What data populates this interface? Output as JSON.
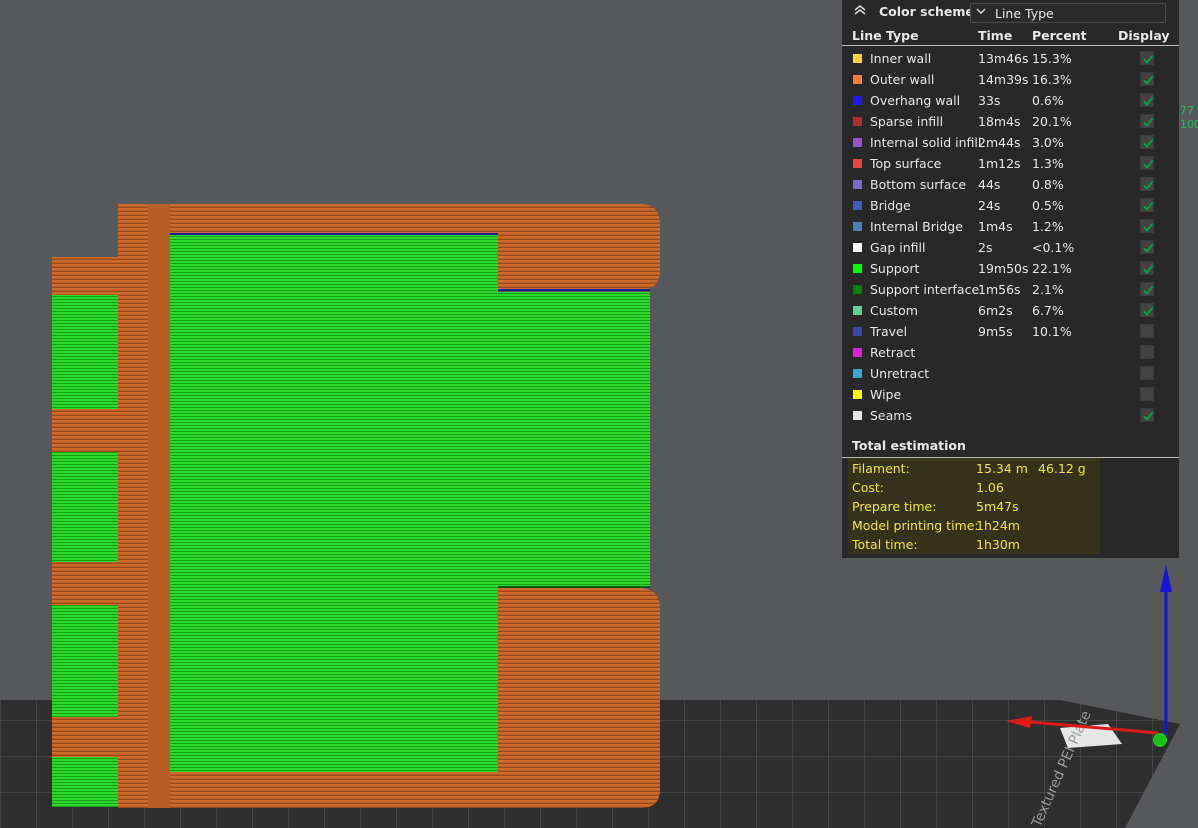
{
  "color_scheme": {
    "label": "Color scheme",
    "selected": "Line Type"
  },
  "legend": {
    "headers": {
      "line_type": "Line Type",
      "time": "Time",
      "percent": "Percent",
      "display": "Display"
    },
    "rows": [
      {
        "name": "Inner wall",
        "time": "13m46s",
        "percent": "15.3%",
        "color": "#ffd23f",
        "display": true
      },
      {
        "name": "Outer wall",
        "time": "14m39s",
        "percent": "16.3%",
        "color": "#ff7d38",
        "display": true
      },
      {
        "name": "Overhang wall",
        "time": "33s",
        "percent": "0.6%",
        "color": "#1a1aff",
        "display": true
      },
      {
        "name": "Sparse infill",
        "time": "18m4s",
        "percent": "20.1%",
        "color": "#b03029",
        "display": true
      },
      {
        "name": "Internal solid infill",
        "time": "2m44s",
        "percent": "3.0%",
        "color": "#9654cc",
        "display": true
      },
      {
        "name": "Top surface",
        "time": "1m12s",
        "percent": "1.3%",
        "color": "#f04040",
        "display": true
      },
      {
        "name": "Bottom surface",
        "time": "44s",
        "percent": "0.8%",
        "color": "#7a6cc4",
        "display": true
      },
      {
        "name": "Bridge",
        "time": "24s",
        "percent": "0.5%",
        "color": "#405cb8",
        "display": true
      },
      {
        "name": "Internal Bridge",
        "time": "1m4s",
        "percent": "1.2%",
        "color": "#4d80ba",
        "display": true
      },
      {
        "name": "Gap infill",
        "time": "2s",
        "percent": "<0.1%",
        "color": "#ffffff",
        "display": true
      },
      {
        "name": "Support",
        "time": "19m50s",
        "percent": "22.1%",
        "color": "#00ff00",
        "display": true
      },
      {
        "name": "Support interface",
        "time": "1m56s",
        "percent": "2.1%",
        "color": "#008000",
        "display": true
      },
      {
        "name": "Custom",
        "time": "6m2s",
        "percent": "6.7%",
        "color": "#5ed194",
        "display": true
      },
      {
        "name": "Travel",
        "time": "9m5s",
        "percent": "10.1%",
        "color": "#3847a8",
        "display": false
      },
      {
        "name": "Retract",
        "time": "",
        "percent": "",
        "color": "#e01fd8",
        "display": false
      },
      {
        "name": "Unretract",
        "time": "",
        "percent": "",
        "color": "#3aa6d6",
        "display": false
      },
      {
        "name": "Wipe",
        "time": "",
        "percent": "",
        "color": "#ffff00",
        "display": false
      },
      {
        "name": "Seams",
        "time": "",
        "percent": "",
        "color": "#e3e3e3",
        "display": true
      }
    ]
  },
  "total_estimation": {
    "title": "Total estimation",
    "filament_label": "Filament:",
    "filament_length": "15.34 m",
    "filament_weight": "46.12 g",
    "cost_label": "Cost:",
    "cost": "1.06",
    "prepare_label": "Prepare time:",
    "prepare_time": "5m47s",
    "model_label": "Model printing time:",
    "model_time": "1h24m",
    "total_label": "Total time:",
    "total_time": "1h30m"
  },
  "viewport": {
    "plate_label": "Textured PEI Plate",
    "side_readout_1": "77",
    "side_readout_2": "100",
    "colors": {
      "outer_wall": "#cd6a2c",
      "support": "#22d322",
      "background": "#57585b",
      "plate": "#2c2c2c"
    }
  }
}
